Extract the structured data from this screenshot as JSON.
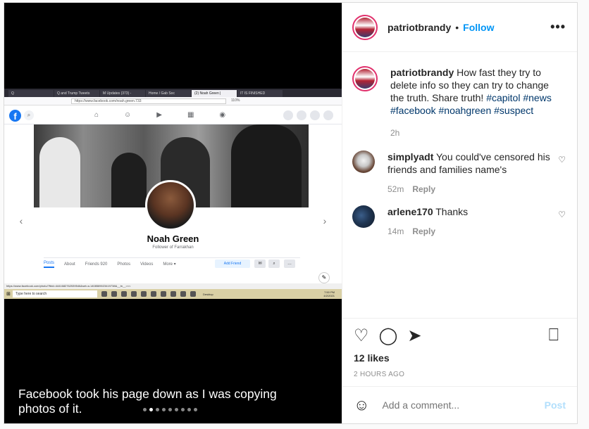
{
  "post": {
    "username": "patriotbrandy",
    "follow_label": "Follow",
    "separator": "•",
    "more_label": "•••",
    "caption_user": "patriotbrandy",
    "caption_text": "How fast they try to delete info so they can try to change the truth. Share truth!",
    "hashtags": [
      "#capitol",
      "#news",
      "#facebook",
      "#noahgreen",
      "#suspect"
    ],
    "caption_time": "2h",
    "likes": "12 likes",
    "timestamp": "2 HOURS AGO",
    "add_comment_placeholder": "Add a comment...",
    "post_label": "Post"
  },
  "comments": [
    {
      "user": "simplyadt",
      "text": "You could've censored his friends and families name's",
      "age": "52m",
      "reply": "Reply"
    },
    {
      "user": "arlene170",
      "text": "Thanks",
      "age": "14m",
      "reply": "Reply"
    }
  ],
  "media": {
    "overlay_text": "Facebook took his page down as I was copying photos of it.",
    "carousel_total": 9,
    "carousel_active": 2,
    "browser_tabs": [
      "Q",
      "Q and Trump Tweets",
      "M Updates (373) -",
      "Home / Gab Soc",
      "(2) Noah Green |",
      "IT IS FINISHED"
    ],
    "url": "https://www.facebook.com/noah.green.733",
    "zoom": "110%",
    "profile_name": "Noah Green",
    "profile_subtitle": "Follower of Farrakhan",
    "profile_tabs": [
      "Posts",
      "About",
      "Friends 920",
      "Photos",
      "Videos",
      "More ▾"
    ],
    "add_friend_label": "Add Friend",
    "status_url": "https://www.facebook.com/photo/?fbid=4441682762539546&set=a.1408589023419738&__tn__=<<",
    "search_placeholder": "Type here to search",
    "desktop_label": "Desktop",
    "clock_time": "7:50 PM",
    "clock_date": "4/2/2021"
  },
  "colors": {
    "accent": "#0095f6",
    "hashtag": "#00376b",
    "muted": "#8e8e8e",
    "fb_blue": "#1877f2"
  }
}
